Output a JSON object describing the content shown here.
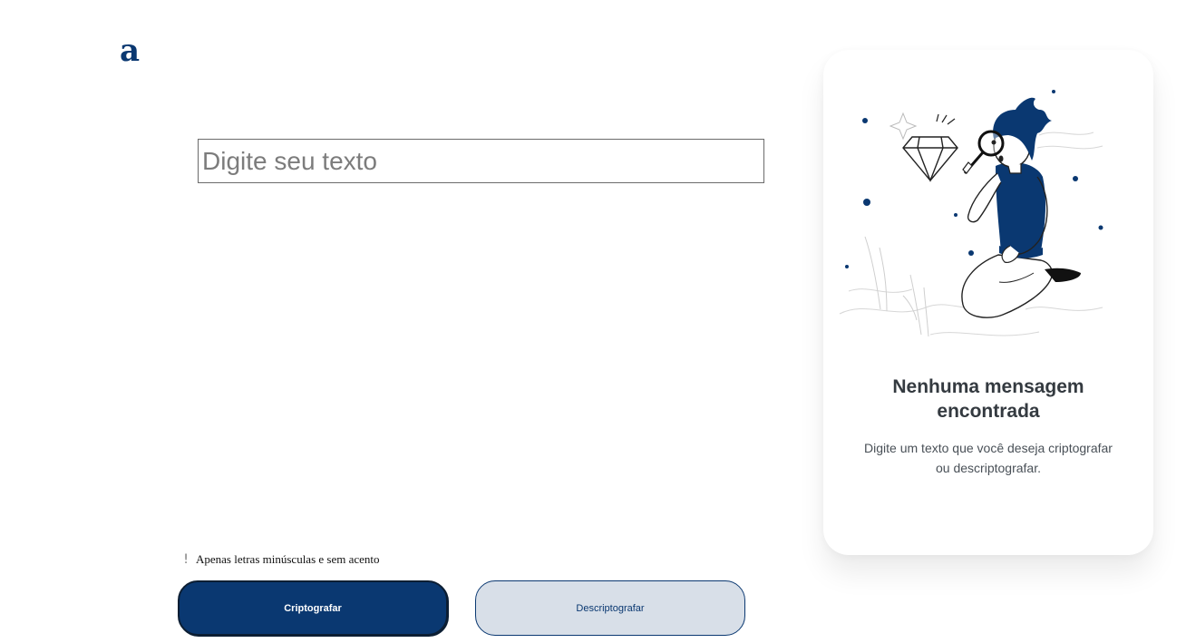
{
  "header": {
    "logo_text": "a"
  },
  "input": {
    "placeholder": "Digite seu texto",
    "value": ""
  },
  "hint": {
    "icon": "exclamation-icon",
    "icon_glyph": "!",
    "text": "Apenas letras minúsculas e sem acento"
  },
  "buttons": {
    "encrypt_label": "Criptografar",
    "decrypt_label": "Descriptografar"
  },
  "output_panel": {
    "illustration": "person-with-magnifying-glass-illustration",
    "title": "Nenhuma mensagem encontrada",
    "description": "Digite um texto que você deseja criptografar ou descriptografar."
  },
  "colors": {
    "brand_dark": "#0a3871",
    "secondary_button_bg": "#d8dfe8",
    "panel_bg": "#ffffff"
  }
}
